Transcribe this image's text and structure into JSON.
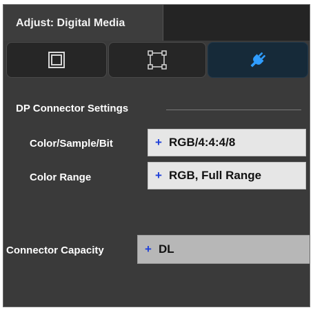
{
  "window": {
    "title": "Adjust: Digital Media"
  },
  "tabs": [
    {
      "icon": "framed-square-icon",
      "selected": false
    },
    {
      "icon": "crop-corners-icon",
      "selected": false
    },
    {
      "icon": "plug-icon",
      "selected": true
    }
  ],
  "section": {
    "heading": "DP Connector Settings"
  },
  "fields": {
    "color_sample_bit": {
      "label": "Color/Sample/Bit",
      "prefix": "+",
      "value": "RGB/4:4:4/8"
    },
    "color_range": {
      "label": "Color Range",
      "prefix": "+",
      "value": "RGB, Full Range"
    },
    "connector_capacity": {
      "label": "Connector Capacity",
      "prefix": "+",
      "value": "DL"
    }
  },
  "colors": {
    "panel_bg": "#3a3a3a",
    "accent_plug": "#2f9dff",
    "plus_sign": "#1e3fd8"
  }
}
